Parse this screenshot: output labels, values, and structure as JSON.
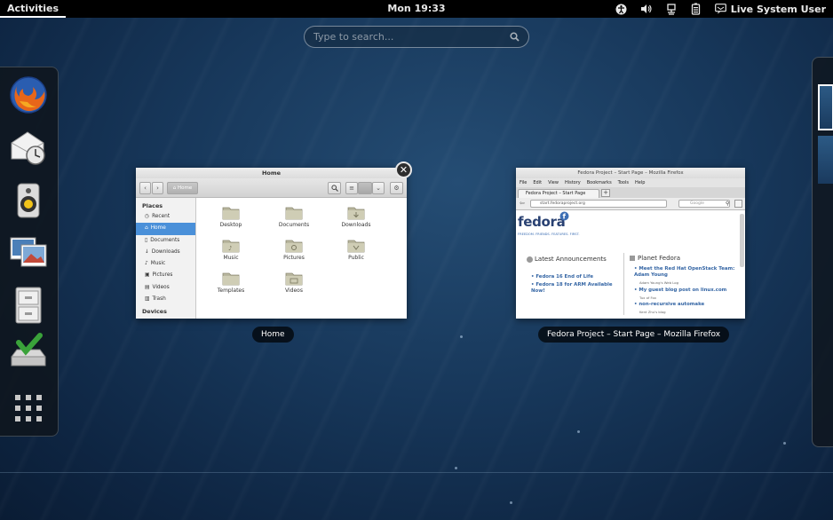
{
  "topbar": {
    "activities": "Activities",
    "clock": "Mon 19:33",
    "user": "Live System User",
    "tray_icons": [
      "accessibility-icon",
      "volume-icon",
      "network-icon",
      "battery-icon",
      "user-icon"
    ]
  },
  "search": {
    "placeholder": "Type to search..."
  },
  "dash": {
    "apps": [
      "firefox",
      "evolution-mail",
      "rhythmbox",
      "shotwell",
      "files",
      "install-to-hard-drive"
    ],
    "show_apps": "show-applications"
  },
  "windows": [
    {
      "caption": "Home",
      "app": "files",
      "title": "Home",
      "path_button": "Home",
      "sidebar": {
        "places_header": "Places",
        "items": [
          "Recent",
          "Home",
          "Documents",
          "Downloads",
          "Music",
          "Pictures",
          "Videos",
          "Trash"
        ],
        "selected": "Home",
        "devices_header": "Devices"
      },
      "folders": [
        "Desktop",
        "Documents",
        "Downloads",
        "Music",
        "Pictures",
        "Public",
        "Templates",
        "Videos"
      ]
    },
    {
      "caption": "Fedora Project – Start Page – Mozilla Firefox",
      "app": "firefox",
      "title": "Fedora Project – Start Page – Mozilla Firefox",
      "menu": [
        "File",
        "Edit",
        "View",
        "History",
        "Bookmarks",
        "Tools",
        "Help"
      ],
      "tab_label": "Fedora Project – Start Page",
      "url": "start.fedoraproject.org",
      "search_engine": "Google",
      "logo": "fedora",
      "tagline": "FREEDOM. FRIENDS. FEATURES. FIRST.",
      "announcements": {
        "heading": "Latest Announcements",
        "items": [
          "Fedora 16 End of Life",
          "Fedora 18 for ARM Available Now!"
        ]
      },
      "planet": {
        "heading": "Planet Fedora",
        "items": [
          {
            "title": "Meet the Red Hat OpenStack Team: Adam Young",
            "sub": "Adam Young's Web Log"
          },
          {
            "title": "My guest blog post on linux.com",
            "sub": "Tux of Fox"
          },
          {
            "title": "non-recursive automake",
            "sub": "Kent Zhu's blog"
          }
        ]
      }
    }
  ],
  "colors": {
    "selection": "#4a90d9",
    "fedora_blue": "#294172",
    "link": "#3465a4"
  }
}
